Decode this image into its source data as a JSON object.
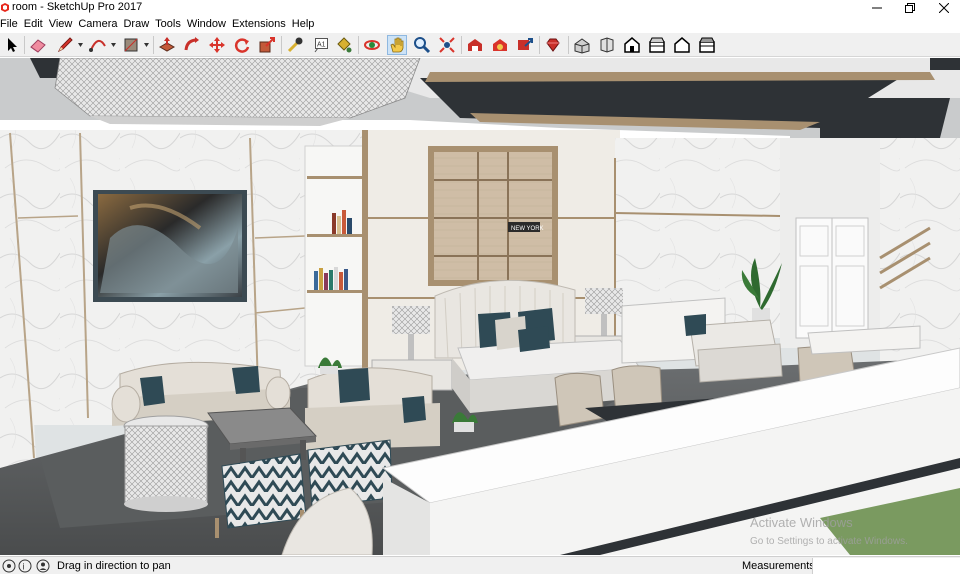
{
  "window": {
    "title": "room - SketchUp Pro 2017",
    "controls": [
      "minimize",
      "restore",
      "close"
    ]
  },
  "menu": {
    "items": [
      "File",
      "Edit",
      "View",
      "Camera",
      "Draw",
      "Tools",
      "Window",
      "Extensions",
      "Help"
    ]
  },
  "toolbar": {
    "tools": [
      {
        "name": "select",
        "icon": "arrow-cursor-icon"
      },
      {
        "name": "eraser",
        "icon": "eraser-icon"
      },
      {
        "name": "line",
        "icon": "pencil-icon"
      },
      {
        "name": "arc",
        "icon": "arc-icon"
      },
      {
        "name": "rectangle",
        "icon": "rectangle-icon"
      },
      {
        "name": "push-pull",
        "icon": "push-pull-icon"
      },
      {
        "name": "follow-me",
        "icon": "follow-me-icon"
      },
      {
        "name": "move",
        "icon": "move-arrows-icon"
      },
      {
        "name": "rotate",
        "icon": "rotate-icon"
      },
      {
        "name": "scale",
        "icon": "scale-icon"
      },
      {
        "name": "tape-measure",
        "icon": "tape-measure-icon"
      },
      {
        "name": "text",
        "icon": "text-label-icon"
      },
      {
        "name": "paint-bucket",
        "icon": "paint-bucket-icon"
      },
      {
        "name": "orbit",
        "icon": "orbit-icon"
      },
      {
        "name": "pan",
        "icon": "hand-pan-icon",
        "active": true
      },
      {
        "name": "zoom",
        "icon": "zoom-icon"
      },
      {
        "name": "zoom-extents",
        "icon": "zoom-extents-icon"
      },
      {
        "name": "3d-warehouse",
        "icon": "warehouse-icon"
      },
      {
        "name": "extension-warehouse",
        "icon": "extension-warehouse-icon"
      },
      {
        "name": "share-model",
        "icon": "share-model-icon"
      },
      {
        "name": "extension-manager",
        "icon": "extension-ruby-icon"
      },
      {
        "name": "view-iso",
        "icon": "iso-view-icon"
      },
      {
        "name": "view-top",
        "icon": "top-view-icon"
      },
      {
        "name": "view-front",
        "icon": "front-view-icon"
      },
      {
        "name": "view-right",
        "icon": "right-view-icon"
      },
      {
        "name": "view-back",
        "icon": "back-view-icon"
      },
      {
        "name": "view-left",
        "icon": "left-view-icon"
      }
    ]
  },
  "scene": {
    "tv_sign": "NEW YORK",
    "activation": {
      "title": "Activate Windows",
      "subtitle": "Go to Settings to activate Windows."
    }
  },
  "status": {
    "message": "Drag in direction to pan",
    "measurements_label": "Measurements",
    "measurements_value": ""
  },
  "colors": {
    "toolbar_bg": "#f0f0f0",
    "active_tool": "#cde3f7",
    "marble": "#f1f1f0",
    "gold_trim": "#a89070",
    "dark_ceiling": "#2e3236",
    "teal_pillow": "#2f4a55",
    "floor_rug": "#5a5d5e"
  }
}
